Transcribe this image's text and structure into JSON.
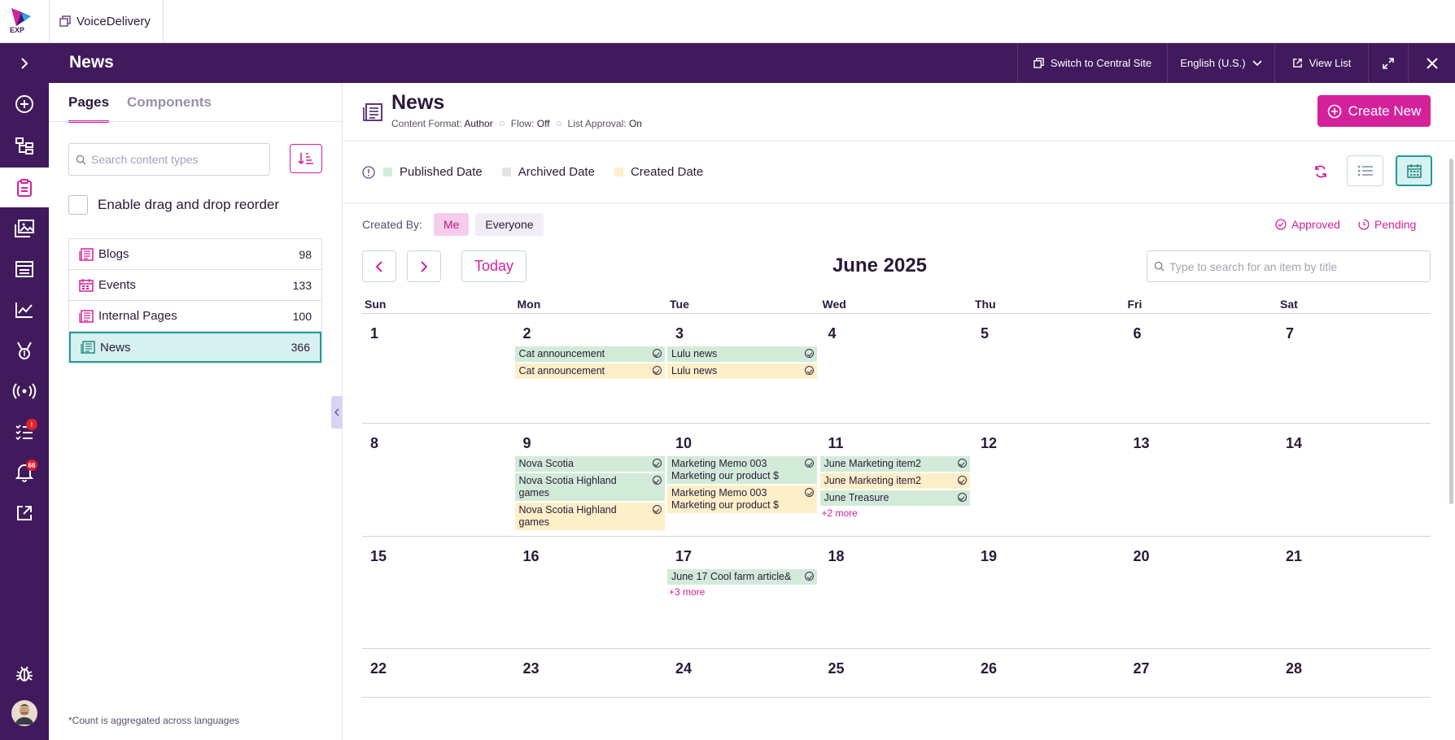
{
  "topbar": {
    "logo_text": "EXP",
    "site_name": "VoiceDelivery"
  },
  "header": {
    "title": "News",
    "switch_label": "Switch to Central Site",
    "language_label": "English (U.S.)",
    "view_list_label": "View List"
  },
  "rail": {
    "tasks_badge": "!",
    "notifications_badge": "66"
  },
  "panel": {
    "tabs": [
      {
        "label": "Pages"
      },
      {
        "label": "Components"
      }
    ],
    "search_placeholder": "Search content types",
    "drag_label": "Enable drag and drop reorder",
    "content_types": [
      {
        "label": "Blogs",
        "count": "98",
        "icon": "newspaper-icon"
      },
      {
        "label": "Events",
        "count": "133",
        "icon": "calendar-icon"
      },
      {
        "label": "Internal Pages",
        "count": "100",
        "icon": "newspaper-icon"
      },
      {
        "label": "News",
        "count": "366",
        "icon": "newspaper-icon"
      }
    ],
    "footnote": "*Count is aggregated across languages"
  },
  "main": {
    "title": "News",
    "meta": {
      "content_format_label": "Content Format:",
      "content_format_value": "Author",
      "flow_label": "Flow:",
      "flow_value": "Off",
      "list_approval_label": "List Approval:",
      "list_approval_value": "On"
    },
    "create_label": "Create New",
    "legend": [
      {
        "label": "Published Date",
        "color": "#cfeed6"
      },
      {
        "label": "Archived Date",
        "color": "#e4e2e6"
      },
      {
        "label": "Created Date",
        "color": "#fdefc8"
      }
    ],
    "created_by_label": "Created By:",
    "created_by_me": "Me",
    "created_by_everyone": "Everyone",
    "approved_label": "Approved",
    "pending_label": "Pending",
    "today_label": "Today",
    "month_title": "June 2025",
    "cal_search_placeholder": "Type to search for an item by title",
    "weekdays": [
      "Sun",
      "Mon",
      "Tue",
      "Wed",
      "Thu",
      "Fri",
      "Sat"
    ],
    "weeks": [
      [
        {
          "day": "1",
          "events": []
        },
        {
          "day": "2",
          "events": [
            {
              "title": "Cat announcement",
              "kind": "pub"
            },
            {
              "title": "Cat announcement",
              "kind": "cre"
            }
          ]
        },
        {
          "day": "3",
          "events": [
            {
              "title": "Lulu news",
              "kind": "pub"
            },
            {
              "title": "Lulu news",
              "kind": "cre"
            }
          ]
        },
        {
          "day": "4",
          "events": []
        },
        {
          "day": "5",
          "events": []
        },
        {
          "day": "6",
          "events": []
        },
        {
          "day": "7",
          "events": []
        }
      ],
      [
        {
          "day": "8",
          "events": []
        },
        {
          "day": "9",
          "events": [
            {
              "title": "Nova Scotia",
              "kind": "pub"
            },
            {
              "title": "Nova Scotia Highland games",
              "kind": "pub"
            },
            {
              "title": "Nova Scotia Highland games",
              "kind": "cre"
            }
          ]
        },
        {
          "day": "10",
          "events": [
            {
              "title": "Marketing Memo 003 Marketing our product $",
              "kind": "pub"
            },
            {
              "title": "Marketing Memo 003 Marketing our product $",
              "kind": "cre"
            }
          ]
        },
        {
          "day": "11",
          "events": [
            {
              "title": "June Marketing item2",
              "kind": "pub"
            },
            {
              "title": "June Marketing item2",
              "kind": "cre"
            },
            {
              "title": "June Treasure",
              "kind": "pub"
            }
          ],
          "more": "+2 more"
        },
        {
          "day": "12",
          "events": []
        },
        {
          "day": "13",
          "events": []
        },
        {
          "day": "14",
          "events": []
        }
      ],
      [
        {
          "day": "15",
          "events": []
        },
        {
          "day": "16",
          "events": []
        },
        {
          "day": "17",
          "events": [
            {
              "title": "June 17 Cool farm article&",
              "kind": "pub"
            }
          ],
          "more": "+3 more"
        },
        {
          "day": "18",
          "events": []
        },
        {
          "day": "19",
          "events": []
        },
        {
          "day": "20",
          "events": []
        },
        {
          "day": "21",
          "events": []
        }
      ],
      [
        {
          "day": "22",
          "events": []
        },
        {
          "day": "23",
          "events": []
        },
        {
          "day": "24",
          "events": []
        },
        {
          "day": "25",
          "events": []
        },
        {
          "day": "26",
          "events": []
        },
        {
          "day": "27",
          "events": []
        },
        {
          "day": "28",
          "events": []
        }
      ]
    ]
  }
}
